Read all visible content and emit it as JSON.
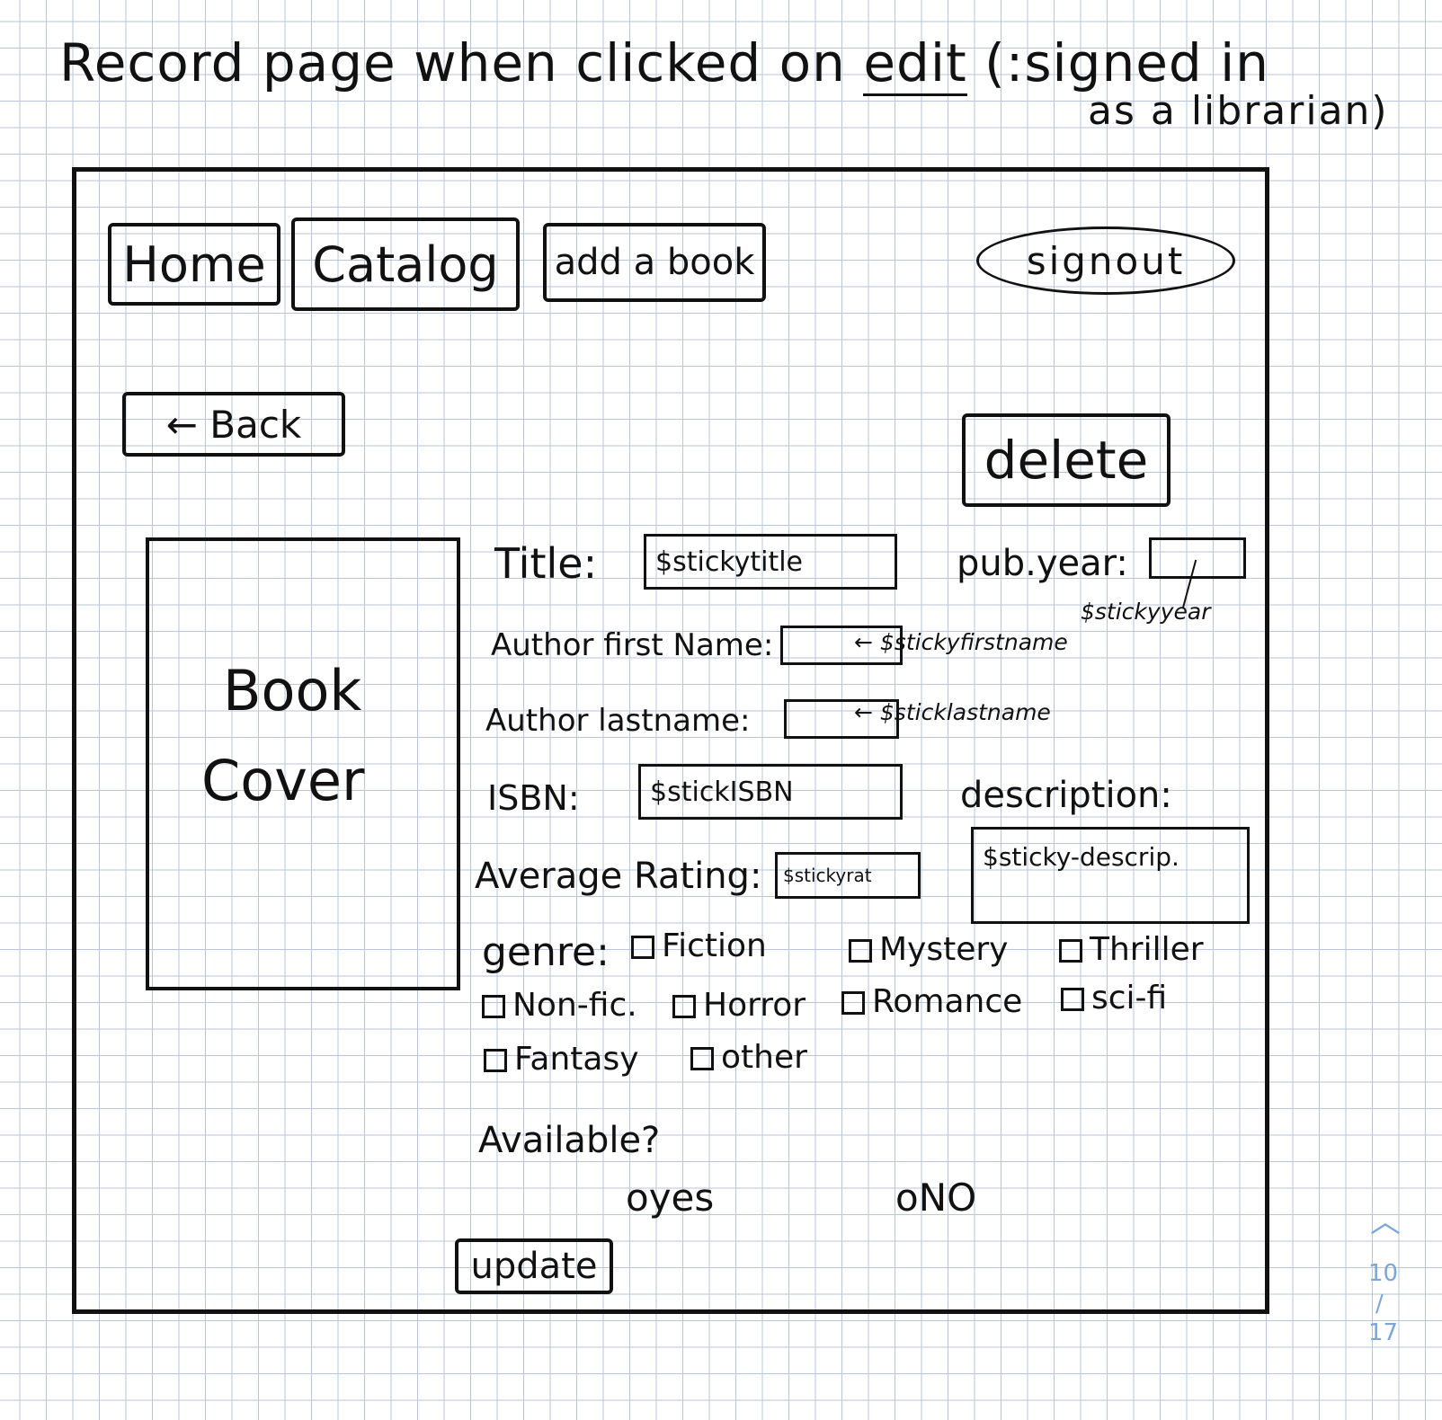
{
  "heading": {
    "line1_a": "Record page when clicked on ",
    "line1_edit": "edit",
    "line1_b": " (:signed in",
    "line2": "as a librarian)"
  },
  "nav": {
    "home": "Home",
    "catalog": "Catalog",
    "add_book": "add a book",
    "sign_out": "signout"
  },
  "back_label": "← Back",
  "delete_label": "delete",
  "cover_line1": "Book",
  "cover_line2": "Cover",
  "form": {
    "title_label": "Title:",
    "title_value": "$stickytitle",
    "pub_year_label": "pub.year:",
    "pub_year_note": "$stickyyear",
    "author_first_label": "Author first Name:",
    "author_first_note": "$stickyfirstname",
    "author_last_label": "Author lastname:",
    "author_last_note": "$sticklastname",
    "isbn_label": "ISBN:",
    "isbn_value": "$stickISBN",
    "description_label": "description:",
    "description_value": "$sticky-descrip.",
    "rating_label": "Average Rating:",
    "rating_value": "$stickyrat",
    "genre_label": "genre:",
    "genres": [
      "Fiction",
      "Mystery",
      "Thriller",
      "Non-fic.",
      "Horror",
      "Romance",
      "sci-fi",
      "Fantasy",
      "other"
    ],
    "available_label": "Available?",
    "yes_label": "yes",
    "no_label": "NO",
    "update_label": "update"
  },
  "pager": {
    "current": "10",
    "separator": "/",
    "total": "17"
  }
}
